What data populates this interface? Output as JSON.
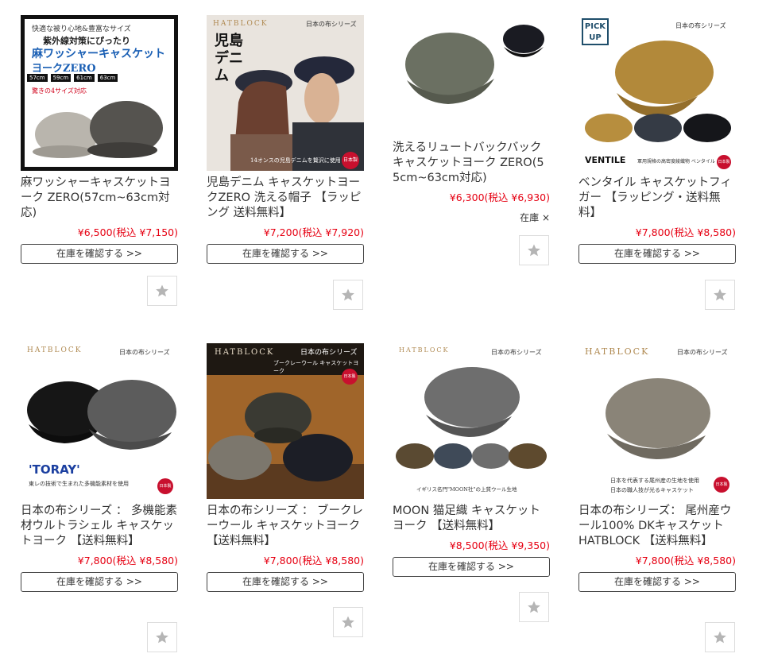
{
  "products": [
    {
      "title": "麻ワッシャーキャスケットヨーク ZERO(57cm~63cm対応)",
      "price": "¥6,500(税込 ¥7,150)",
      "button": "在庫を確認する >>",
      "image": {
        "lines": [
          "快適な被り心地&豊富なサイズ",
          "紫外線対策にぴったり",
          "麻ワッシャーキャスケット",
          "ヨークZERO"
        ],
        "sizes": [
          "57cm",
          "59cm",
          "61cm",
          "63cm"
        ],
        "note": "驚きの4サイズ対応"
      },
      "fav_icon": "star-icon"
    },
    {
      "title": "児島デニム キャスケットヨークZERO 洗える帽子 【ラッピング 送料無料】",
      "price": "¥7,200(税込 ¥7,920)",
      "button": "在庫を確認する >>",
      "image": {
        "brand": "HATBLOCK",
        "series": "日本の布シリーズ",
        "big": "児島デニム",
        "caption": "14オンスの児島デニムを贅沢に使用",
        "badge": "日本製"
      },
      "fav_icon": "star-icon"
    },
    {
      "title": "洗えるリュートバックバックキャスケットヨーク ZERO(55cm~63cm対応)",
      "price": "¥6,300(税込 ¥6,930)",
      "stock": "在庫 ×",
      "fav_icon": "star-icon"
    },
    {
      "title": "ベンタイル キャスケットフィガー 【ラッピング・送料無料】",
      "price": "¥7,800(税込 ¥8,580)",
      "button": "在庫を確認する >>",
      "image": {
        "pick": "PICK UP",
        "series": "日本の布シリーズ",
        "brand": "VENTILE",
        "caption": "軍用規格の高密度綾織物 ベンタイル",
        "badge": "日本製"
      },
      "fav_icon": "star-icon"
    },
    {
      "title": "日本の布シリーズ ： 多機能素材ウルトラシェル キャスケットヨーク 【送料無料】",
      "price": "¥7,800(税込 ¥8,580)",
      "button": "在庫を確認する >>",
      "image": {
        "brand": "HATBLOCK",
        "series": "日本の布シリーズ",
        "logo": "'TORAY'",
        "caption": "東レの技術で生まれた多機能素材を使用",
        "badge": "日本製"
      },
      "fav_icon": "star-icon"
    },
    {
      "title": "日本の布シリーズ ： ブークレーウール キャスケットヨーク 【送料無料】",
      "price": "¥7,800(税込 ¥8,580)",
      "button": "在庫を確認する >>",
      "image": {
        "brand": "HATBLOCK",
        "series": "日本の布シリーズ",
        "sub": "ブークレーウール キャスケットヨーク",
        "badge": "日本製"
      },
      "fav_icon": "star-icon"
    },
    {
      "title": "MOON 猫足織 キャスケットヨーク 【送料無料】",
      "price": "¥8,500(税込 ¥9,350)",
      "button": "在庫を確認する >>",
      "image": {
        "brand": "HATBLOCK",
        "series": "日本の布シリーズ",
        "caption": "イギリス名門\"MOON社\"の上質ウール生地"
      },
      "fav_icon": "star-icon"
    },
    {
      "title": "日本の布シリーズ： 尾州産ウール100% DKキャスケット HATBLOCK 【送料無料】",
      "price": "¥7,800(税込 ¥8,580)",
      "button": "在庫を確認する >>",
      "image": {
        "brand": "HATBLOCK",
        "series": "日本の布シリーズ",
        "caption1": "日本を代表する尾州産の生地を使用",
        "caption2": "日本の職人技が光るキャスケット",
        "badge": "日本製"
      },
      "fav_icon": "star-icon"
    }
  ]
}
